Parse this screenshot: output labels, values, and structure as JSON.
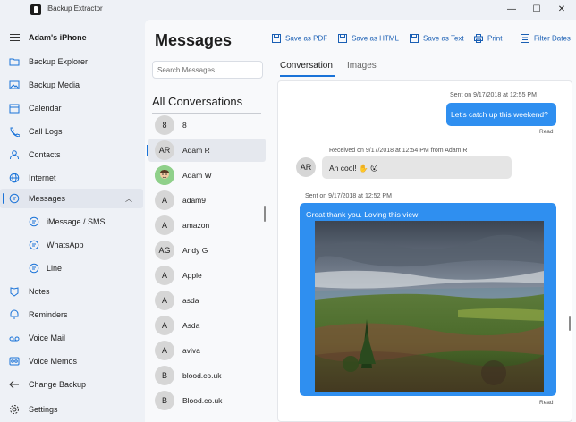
{
  "window": {
    "title": "iBackup Extractor",
    "controls": [
      "—",
      "☐",
      "✕"
    ]
  },
  "sidebar": {
    "device_name": "Adam's iPhone",
    "items": [
      {
        "label": "Backup Explorer",
        "icon": "folder-icon"
      },
      {
        "label": "Backup Media",
        "icon": "image-icon"
      },
      {
        "label": "Calendar",
        "icon": "calendar-icon"
      },
      {
        "label": "Call Logs",
        "icon": "phone-icon"
      },
      {
        "label": "Contacts",
        "icon": "contact-icon"
      },
      {
        "label": "Internet",
        "icon": "globe-icon"
      },
      {
        "label": "Messages",
        "icon": "chat-icon"
      },
      {
        "label": "iMessage / SMS",
        "icon": "chat-icon"
      },
      {
        "label": "WhatsApp",
        "icon": "chat-icon"
      },
      {
        "label": "Line",
        "icon": "chat-icon"
      },
      {
        "label": "Notes",
        "icon": "notes-icon"
      },
      {
        "label": "Reminders",
        "icon": "reminder-icon"
      },
      {
        "label": "Voice Mail",
        "icon": "voicemail-icon"
      },
      {
        "label": "Voice Memos",
        "icon": "voicememo-icon"
      },
      {
        "label": "Change Backup",
        "icon": "back-arrow-icon"
      },
      {
        "label": "Settings",
        "icon": "gear-icon"
      }
    ]
  },
  "main": {
    "title": "Messages",
    "toolbar": {
      "save_pdf": "Save as PDF",
      "save_html": "Save as HTML",
      "save_text": "Save as Text",
      "print": "Print",
      "filter_dates": "Filter Dates"
    },
    "search_placeholder": "Search Messages",
    "list_heading": "All Conversations",
    "conversations": [
      {
        "initials": "8",
        "name": "8"
      },
      {
        "initials": "AR",
        "name": "Adam R"
      },
      {
        "initials": "",
        "name": "Adam W"
      },
      {
        "initials": "A",
        "name": "adam9"
      },
      {
        "initials": "A",
        "name": "amazon"
      },
      {
        "initials": "AG",
        "name": "Andy G"
      },
      {
        "initials": "A",
        "name": "Apple"
      },
      {
        "initials": "A",
        "name": "asda"
      },
      {
        "initials": "A",
        "name": "Asda"
      },
      {
        "initials": "A",
        "name": "aviva"
      },
      {
        "initials": "B",
        "name": "blood.co.uk"
      },
      {
        "initials": "B",
        "name": "Blood.co.uk"
      }
    ],
    "tabs": {
      "conversation": "Conversation",
      "images": "Images"
    },
    "messages": {
      "m1_meta": "Sent on 9/17/2018 at 12:55 PM",
      "m1_text": "Let's catch up this weekend?",
      "m1_status": "Read",
      "m2_meta": "Received on 9/17/2018 at 12:54 PM from Adam R",
      "m2_avatar": "AR",
      "m2_text": "Ah cool! ✋ 😮",
      "m3_meta": "Sent on 9/17/2018 at 12:52 PM",
      "m3_text": "Great thank you. Loving this view",
      "m3_status": "Read"
    }
  },
  "colors": {
    "accent": "#1a73d8",
    "bubble_out": "#2f8ff0",
    "bubble_in": "#e5e5e5"
  }
}
